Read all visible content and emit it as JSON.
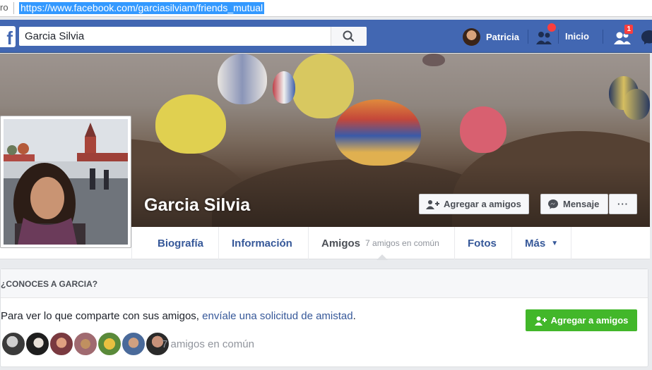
{
  "browser": {
    "url_prefix": "ro",
    "url": "https://www.facebook.com/garciasilviam/friends_mutual"
  },
  "topnav": {
    "logo": "f",
    "search_value": "Garcia Silvia",
    "user_name": "Patricia",
    "home_label": "Inicio",
    "friend_requests_badge": "1",
    "icons": [
      "search-icon",
      "friend-requests-icon",
      "friends-icon",
      "messenger-icon"
    ]
  },
  "profile": {
    "name": "Garcia Silvia",
    "add_friend_label": "Agregar a amigos",
    "message_label": "Mensaje",
    "more_label": "···"
  },
  "tabs": [
    {
      "label": "Biografía"
    },
    {
      "label": "Información"
    },
    {
      "label": "Amigos",
      "sub": "7 amigos en común"
    },
    {
      "label": "Fotos"
    },
    {
      "label": "Más",
      "arrow": "▼"
    }
  ],
  "card": {
    "header": "¿CONOCES A GARCIA?",
    "text_prefix": "Para ver lo que comparte con sus amigos, ",
    "text_link": "envíale una solicitud de amistad",
    "text_suffix": ".",
    "button_label": "Agregar a amigos",
    "mutual_count": "7 amigos en común"
  },
  "colors": {
    "brand": "#4267b2",
    "link": "#365899",
    "green": "#42b72a",
    "badge": "#fa3e3e"
  }
}
